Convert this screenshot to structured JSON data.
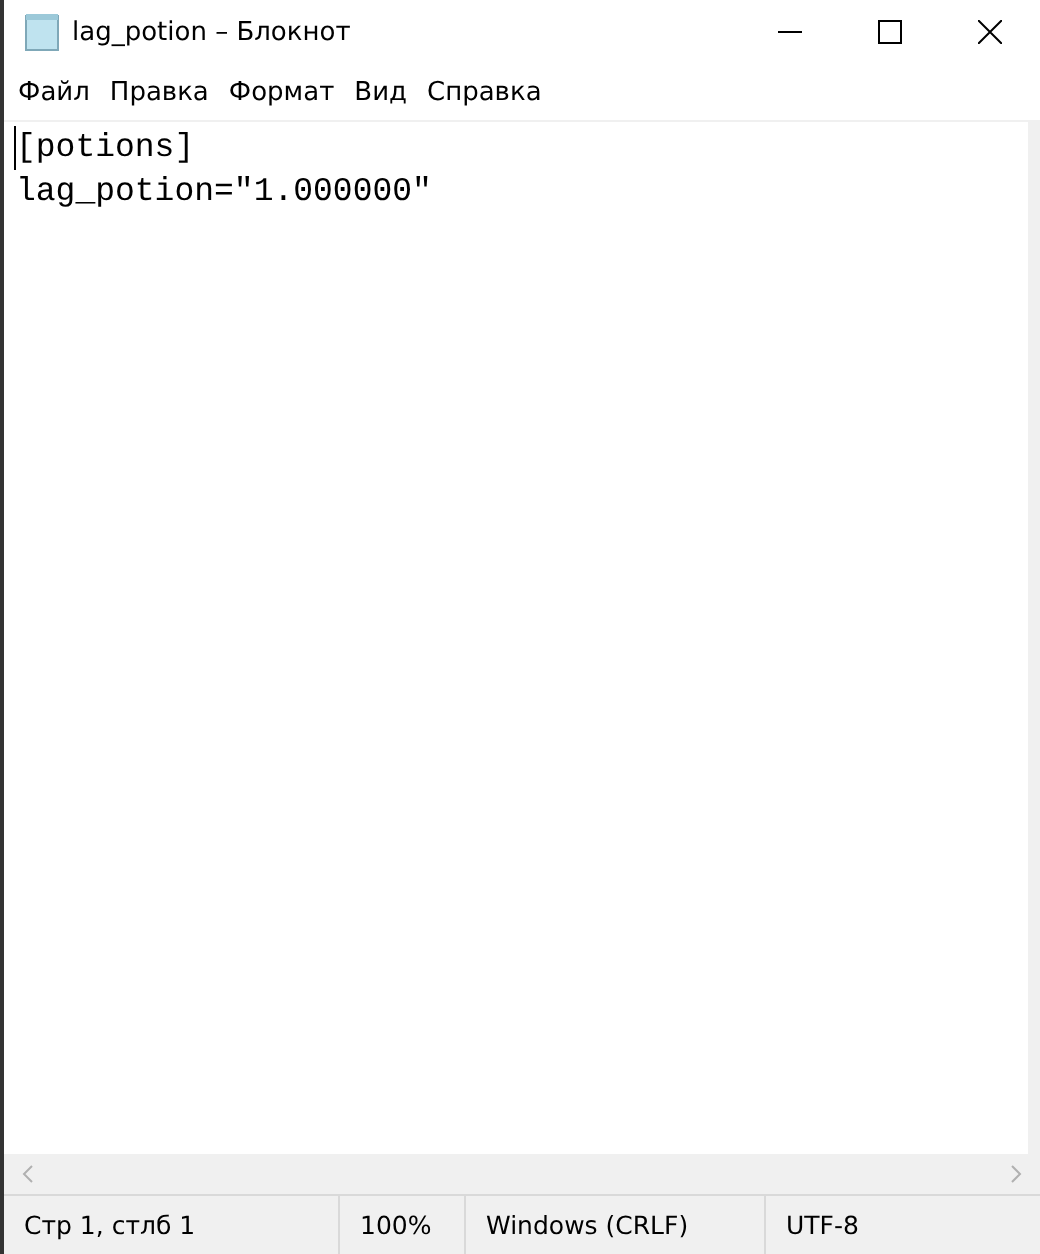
{
  "window": {
    "title": "lag_potion – Блокнот"
  },
  "menu": [
    "Файл",
    "Правка",
    "Формат",
    "Вид",
    "Справка"
  ],
  "editor": {
    "lines": [
      "[potions]",
      "lag_potion=\"1.000000\""
    ]
  },
  "status_bar": [
    "Стр 1, стлб 1",
    "100%",
    "Windows (CRLF)",
    "UTF-8"
  ]
}
